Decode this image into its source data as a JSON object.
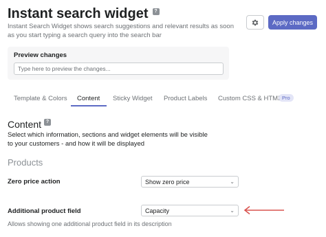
{
  "header": {
    "title": "Instant search widget",
    "help_badge": "?",
    "subtitle": "Instant Search Widget shows search suggestions and relevant results as soon as you start typing a search query into the search bar",
    "apply_label": "Apply changes"
  },
  "preview": {
    "label": "Preview changes",
    "placeholder": "Type here to preview the changes..."
  },
  "tabs": [
    {
      "label": "Template & Colors",
      "active": false
    },
    {
      "label": "Content",
      "active": true
    },
    {
      "label": "Sticky Widget",
      "active": false
    },
    {
      "label": "Product Labels",
      "active": false
    },
    {
      "label": "Custom CSS & HTML",
      "active": false,
      "badge": "Pro"
    }
  ],
  "content": {
    "heading": "Content",
    "help_badge": "?",
    "description": "Select which information, sections and widget elements will be visible to your customers - and how it will be displayed",
    "section_title": "Products",
    "fields": [
      {
        "label": "Zero price action",
        "value": "Show zero price"
      },
      {
        "label": "Additional product field",
        "value": "Capacity",
        "help": "Allows showing one additional product field in its description"
      }
    ]
  },
  "colors": {
    "accent": "#5c6ac4",
    "arrow": "#d9534f"
  },
  "icons": {
    "settings": "gear-icon",
    "dropdown": "chevron-down-icon",
    "annotation": "arrow-left-icon"
  }
}
